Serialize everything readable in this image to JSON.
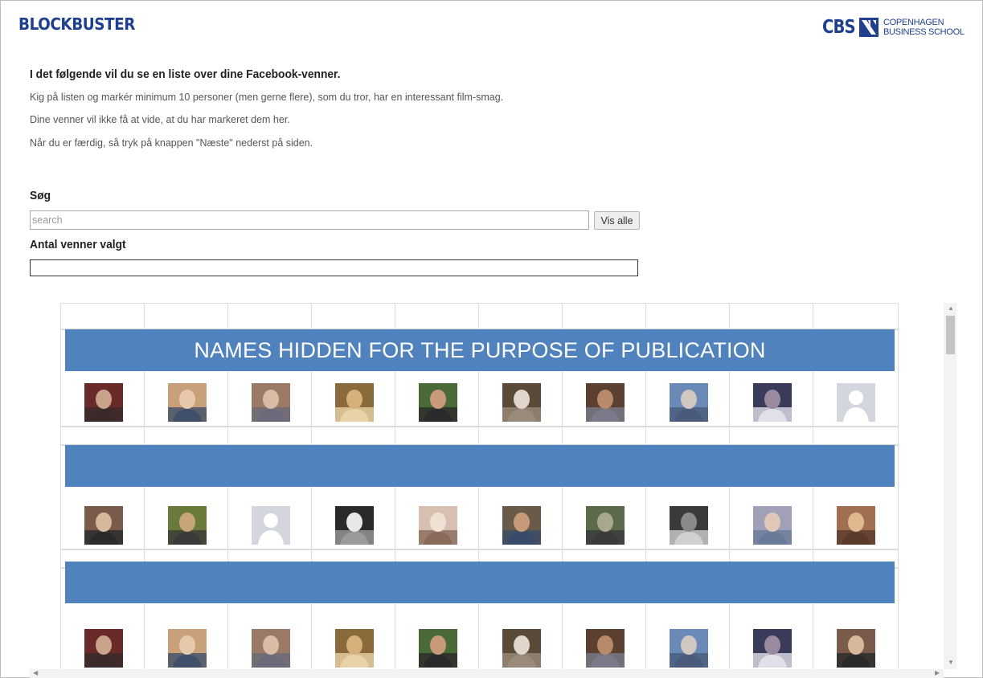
{
  "header": {
    "brand": "BLOCKBUSTER",
    "cbs_logo_text": "CBS",
    "cbs_name_line1": "COPENHAGEN",
    "cbs_name_line2": "BUSINESS SCHOOL"
  },
  "intro": {
    "title": "I det følgende vil du se en liste over dine Facebook-venner.",
    "line1": "Kig på listen og markér minimum 10 personer (men gerne flere), som du tror, har en interessant film-smag.",
    "line2": "Dine venner vil ikke få at vide, at du har markeret dem her.",
    "line3": "Når du er færdig, så tryk på knappen \"Næste\" nederst på siden."
  },
  "search": {
    "label": "Søg",
    "placeholder": "search",
    "value": "",
    "show_all_label": "Vis alle"
  },
  "selected": {
    "label": "Antal venner valgt",
    "value": ""
  },
  "grid": {
    "overlay_text": "NAMES HIDDEN FOR THE PURPOSE OF PUBLICATION",
    "overlay_color": "#5082be",
    "rows": [
      {
        "photos": [
          "friend-photo",
          "friend-photo",
          "friend-photo",
          "friend-photo",
          "friend-photo",
          "friend-photo",
          "friend-photo",
          "friend-photo",
          "friend-photo",
          "default-avatar"
        ]
      },
      {
        "photos": [
          "friend-photo",
          "friend-photo",
          "default-avatar",
          "friend-photo",
          "friend-photo",
          "friend-photo",
          "friend-photo",
          "friend-photo",
          "friend-photo",
          "friend-photo"
        ]
      },
      {
        "photos": [
          "friend-photo",
          "friend-photo",
          "friend-photo",
          "friend-photo",
          "friend-photo",
          "friend-photo",
          "friend-photo",
          "friend-photo",
          "friend-photo",
          "friend-photo"
        ]
      }
    ]
  },
  "colors": {
    "brand": "#1f3f8f",
    "band": "#5082be"
  }
}
